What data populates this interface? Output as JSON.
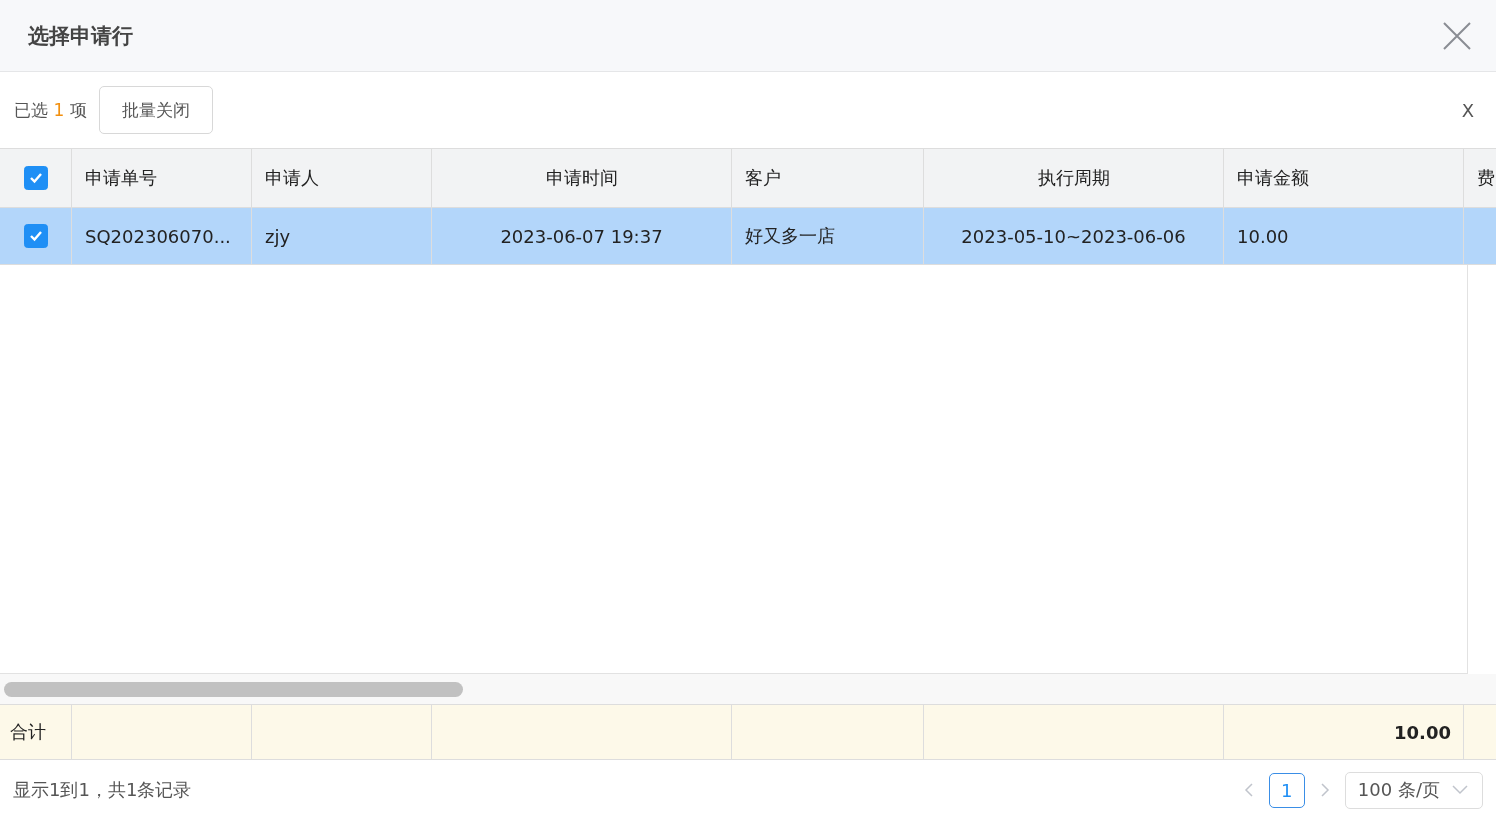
{
  "dialog": {
    "title": "选择申请行"
  },
  "toolbar": {
    "selected_prefix": "已选",
    "selected_count": "1",
    "selected_suffix": "项",
    "batch_button": "批量关闭",
    "clear_label": "X"
  },
  "table": {
    "all_checked": true,
    "columns": [
      {
        "label": "申请单号"
      },
      {
        "label": "申请人"
      },
      {
        "label": "申请时间"
      },
      {
        "label": "客户"
      },
      {
        "label": "执行周期"
      },
      {
        "label": "申请金额"
      },
      {
        "label": "费"
      }
    ],
    "rows": [
      {
        "selected": true,
        "cells": [
          "SQ202306070...",
          "zjy",
          "2023-06-07 19:37",
          "好又多一店",
          "2023-05-10~2023-06-06",
          "10.00",
          ""
        ]
      }
    ],
    "summary": {
      "label": "合计",
      "cells": [
        "",
        "",
        "",
        "",
        "",
        "10.00",
        ""
      ]
    }
  },
  "footer": {
    "record_info": "显示1到1，共1条记录",
    "pages": [
      {
        "label": "1",
        "selected": true
      }
    ],
    "page_size": "100 条/页"
  }
}
